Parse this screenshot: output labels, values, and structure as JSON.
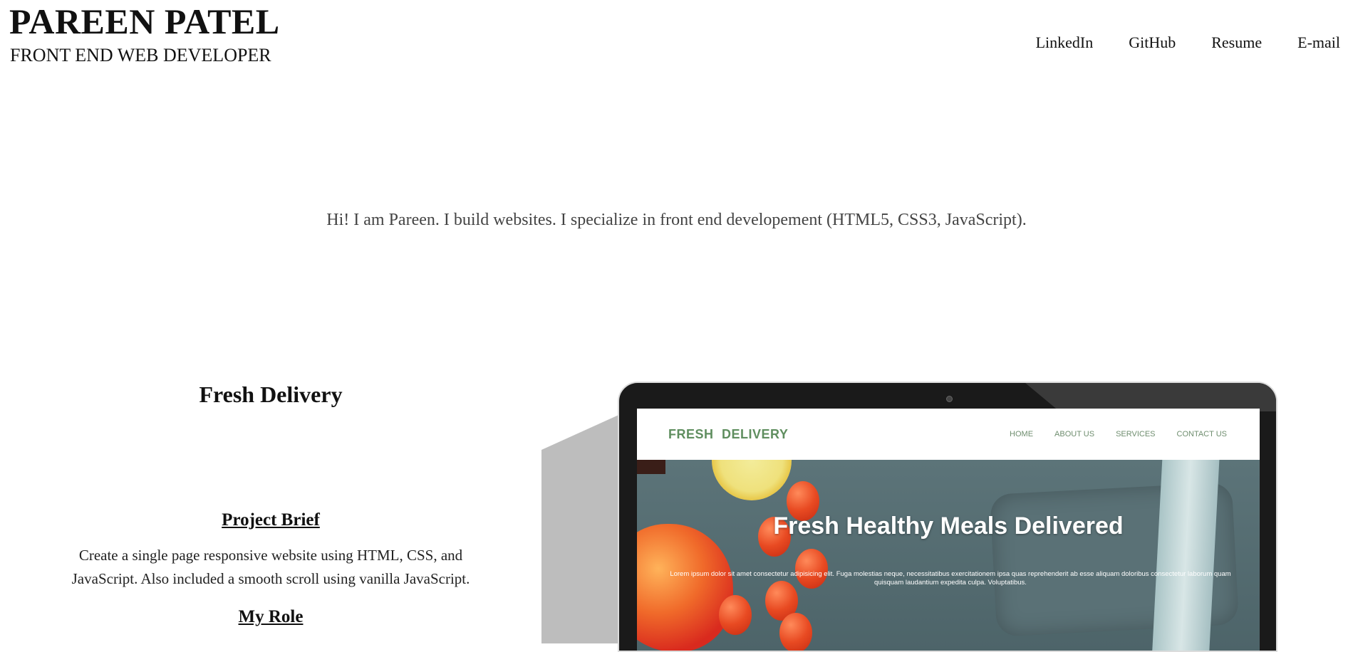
{
  "header": {
    "name": "PAREEN PATEL",
    "title": "FRONT END WEB DEVELOPER"
  },
  "nav": {
    "items": [
      "LinkedIn",
      "GitHub",
      "Resume",
      "E-mail"
    ]
  },
  "intro": {
    "text": "Hi! I am Pareen. I build websites. I specialize in front end developement (HTML5, CSS3, JavaScript)."
  },
  "project": {
    "title": "Fresh Delivery",
    "brief_heading": "Project Brief",
    "brief_text": "Create a single page responsive website using HTML, CSS, and JavaScript. Also included a smooth scroll using vanilla JavaScript.",
    "role_heading": "My Role"
  },
  "mockup": {
    "logo": "FRESH  DELIVERY",
    "links": [
      "HOME",
      "ABOUT US",
      "SERVICES",
      "CONTACT US"
    ],
    "hero_title": "Fresh Healthy Meals Delivered",
    "hero_text": "Lorem ipsum dolor sit amet consectetur adipisicing elit. Fuga molestias neque, necessitatibus exercitationem ipsa quas reprehenderit ab esse aliquam doloribus consectetur laborum quam quisquam laudantium expedita culpa. Voluptatibus."
  }
}
